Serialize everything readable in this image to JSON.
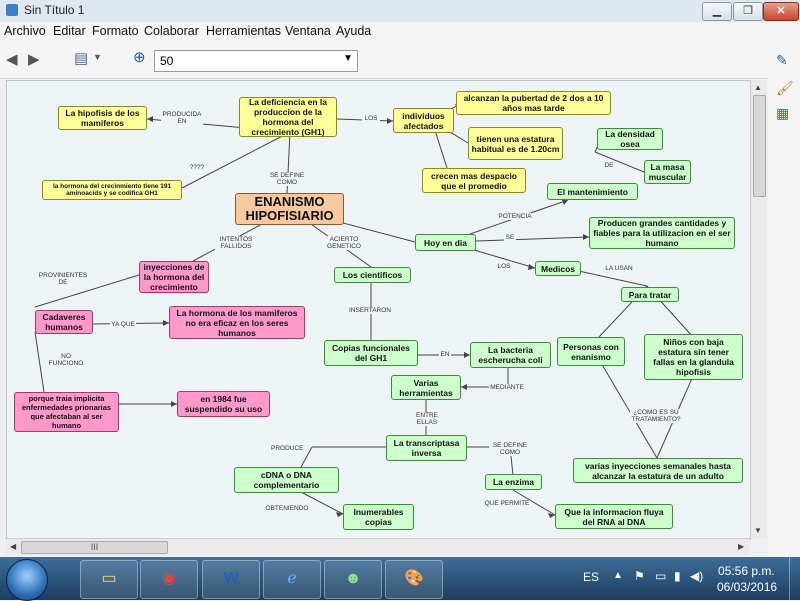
{
  "window": {
    "title": "Sin Título 1",
    "buttons": {
      "minimize": "▁",
      "maximize": "❐",
      "close": "✕"
    }
  },
  "menu": [
    "Archivo",
    "Editar",
    "Formato",
    "Colaborar",
    "Herramientas",
    "Ventana",
    "Ayuda"
  ],
  "toolbar": {
    "zoom_value": "50"
  },
  "nodes": {
    "root": "ENANISMO HIPOFISIARIO",
    "deficiencia": "La deficiencia en la produccion de la hormona del crecimiento (GH1)",
    "hipofisis": "La hipofisis de los mamiferos",
    "hormona": "la hormona del crecinmiento tiene 191 aminoacids y se codifica GH1",
    "afectados": "individuos afectados",
    "pubertad": "alcanzan la pubertad de 2 dos a 10 años mas tarde",
    "estatura": "tienen una estatura habitual es de 1.20cm",
    "crecen": "crecen mas despacio que el promedio",
    "densidad": "La densidad osea",
    "masa": "La masa muscular",
    "mantenimiento": "El mantenimiento",
    "producen": "Producen grandes cantidades y fiables para la utilizacion en el ser humano",
    "hoy": "Hoy en dia",
    "medicos": "Medicos",
    "para_tratar": "Para tratar",
    "personas": "Personas con enanismo",
    "ninos": "Niños con baja estatura sin tener fallas en la glandula hipofisis",
    "inyecciones_semanales": "varias inyecciones semanales hasta alcanzar la estatura de un adulto",
    "cientificos": "Los cientificos",
    "copias": "Copias funcionales del GH1",
    "bacteria": "La bacteria escherucha coli",
    "herramientas": "Varias herramientas",
    "transcriptasa": "La transcriptasa inversa",
    "enzima": "La enzima",
    "flujo": "Que la informacion fluya del RNA al DNA",
    "cdna": "cDNA o DNA complementario",
    "inumerables": "Inumerables copias",
    "inyecciones": "inyecciones de la hormona del crecimiento",
    "cadaveres": "Cadaveres humanos",
    "no_eficaz": "La hormona de los mamiferos no era eficaz en los seres humanos",
    "priones": "porque traia implicita enfermedades prionarias que afectaban al ser humano",
    "suspendido": "en 1984 fue suspendido su uso"
  },
  "links": {
    "producida_en": "PRODUCIDA EN",
    "los": "LOS",
    "interrog": "????",
    "se_define_como": "SE DEFINE COMO",
    "de": "DE",
    "potencia": "POTENCIA",
    "se": "SE",
    "los2": "LOS",
    "la_usan": "LA USAN",
    "intentos_fallidos": "INTENTOS FALLIDOS",
    "acierto_genetico": "ACIERTO GENETICO",
    "provinientes_de": "PROVINIENTES DE",
    "ya_que": "YA QUE",
    "no_funciono": "NO FUNCIONO",
    "insertaron": "INSERTARON",
    "en": "EN",
    "mediante": "MEDIANTE",
    "entre_ellas": "ENTRE ELLAS",
    "produce": "PRODUCE",
    "se_define_como2": "SE DEFINE COMO",
    "que_permite": "QUE PERMITE",
    "obteniendo": "OBTENIENDO",
    "como_tratamiento": "¿COMO ES SU TRATAMIENTO?"
  },
  "hscroll_grip": "III",
  "taskbar": {
    "lang": "ES",
    "time": "05:56 p.m.",
    "date": "06/03/2016"
  },
  "colors": {
    "yellow": "#ffff99",
    "green": "#ccffcc",
    "pink": "#ff99cc",
    "orange": "#f8c9a0"
  }
}
